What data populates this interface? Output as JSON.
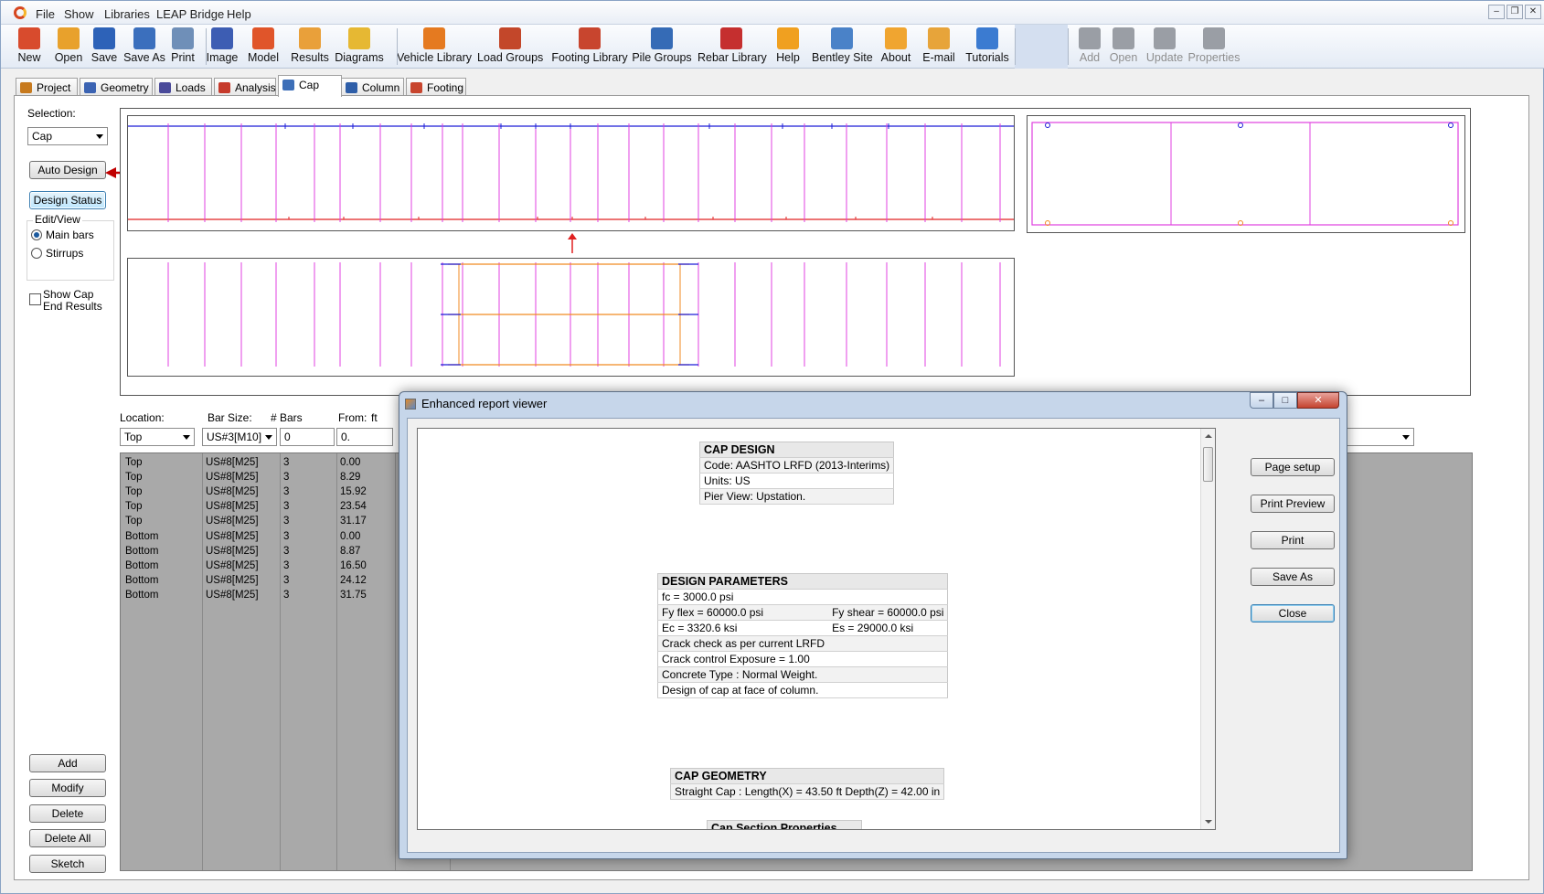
{
  "menu": [
    "File",
    "Show",
    "Libraries",
    "LEAP Bridge",
    "Help"
  ],
  "toolbar": [
    {
      "label": "New",
      "icon": "new-file-icon",
      "color": "#d84b2d"
    },
    {
      "label": "Open",
      "icon": "open-folder-icon",
      "color": "#e8a12c"
    },
    {
      "label": "Save",
      "icon": "save-disk-icon",
      "color": "#2d62b8"
    },
    {
      "label": "Save As",
      "icon": "save-as-icon",
      "color": "#3b6fbd"
    },
    {
      "label": "Print",
      "icon": "printer-icon",
      "color": "#6f8fb8"
    },
    {
      "label": "Image",
      "icon": "image-icon",
      "color": "#3d5db3"
    },
    {
      "label": "Model",
      "icon": "model-grid-icon",
      "color": "#e0552a"
    },
    {
      "label": "Results",
      "icon": "results-icon",
      "color": "#e9a03a"
    },
    {
      "label": "Diagrams",
      "icon": "diagrams-icon",
      "color": "#e6b833"
    },
    {
      "label": "Vehicle Library",
      "icon": "truck-icon",
      "color": "#e57a20"
    },
    {
      "label": "Load Groups",
      "icon": "load-groups-icon",
      "color": "#c3472a"
    },
    {
      "label": "Footing Library",
      "icon": "footing-icon",
      "color": "#c8452e"
    },
    {
      "label": "Pile Groups",
      "icon": "pile-groups-icon",
      "color": "#356bb6"
    },
    {
      "label": "Rebar Library",
      "icon": "rebar-icon",
      "color": "#c52f2f"
    },
    {
      "label": "Help",
      "icon": "help-icon",
      "color": "#f0a020"
    },
    {
      "label": "Bentley Site",
      "icon": "bentley-site-icon",
      "color": "#4a82c8"
    },
    {
      "label": "About",
      "icon": "about-icon",
      "color": "#f0a530"
    },
    {
      "label": "E-mail",
      "icon": "email-icon",
      "color": "#e7a43a"
    },
    {
      "label": "Tutorials",
      "icon": "tutorials-icon",
      "color": "#3b7bd1"
    },
    {
      "label": "Add",
      "icon": "add-icon",
      "color": "#8a8a8a"
    },
    {
      "label": "Open",
      "icon": "open-disabled-icon",
      "color": "#8a8a8a"
    },
    {
      "label": "Update",
      "icon": "update-icon",
      "color": "#8a8a8a"
    },
    {
      "label": "Properties",
      "icon": "properties-icon",
      "color": "#8a8a8a"
    }
  ],
  "tabs": [
    {
      "label": "Project",
      "icon": "project-icon",
      "color": "#c77a1e"
    },
    {
      "label": "Geometry",
      "icon": "geometry-icon",
      "color": "#3b63b2"
    },
    {
      "label": "Loads",
      "icon": "loads-icon",
      "color": "#4a4a9a"
    },
    {
      "label": "Analysis",
      "icon": "analysis-icon",
      "color": "#c63a2b"
    },
    {
      "label": "Cap",
      "icon": "cap-icon",
      "color": "#3d6fb8"
    },
    {
      "label": "Column",
      "icon": "column-icon",
      "color": "#2e5ea8"
    },
    {
      "label": "Footing",
      "icon": "footing-tab-icon",
      "color": "#c8452e"
    }
  ],
  "left": {
    "selection_label": "Selection:",
    "selection_value": "Cap",
    "auto_design": "Auto Design",
    "design_status": "Design Status",
    "edit_view": "Edit/View",
    "main_bars": "Main bars",
    "stirrups": "Stirrups",
    "show_cap_end": "Show Cap End Results",
    "add": "Add",
    "modify": "Modify",
    "delete": "Delete",
    "delete_all": "Delete All",
    "sketch": "Sketch"
  },
  "bar_editor": {
    "location_label": "Location:",
    "bar_size_label": "Bar Size:",
    "nbars_label": "# Bars",
    "from_label": "From:",
    "from_unit": "ft",
    "location_value": "Top",
    "bar_size_value": "US#3[M10]",
    "nbars_value": "0",
    "from_value": "0."
  },
  "bars": [
    {
      "location": "Top",
      "size": "US#8[M25]",
      "count": "3",
      "from": "0.00"
    },
    {
      "location": "Top",
      "size": "US#8[M25]",
      "count": "3",
      "from": "8.29"
    },
    {
      "location": "Top",
      "size": "US#8[M25]",
      "count": "3",
      "from": "15.92"
    },
    {
      "location": "Top",
      "size": "US#8[M25]",
      "count": "3",
      "from": "23.54"
    },
    {
      "location": "Top",
      "size": "US#8[M25]",
      "count": "3",
      "from": "31.17"
    },
    {
      "location": "Bottom",
      "size": "US#8[M25]",
      "count": "3",
      "from": "0.00"
    },
    {
      "location": "Bottom",
      "size": "US#8[M25]",
      "count": "3",
      "from": "8.87"
    },
    {
      "location": "Bottom",
      "size": "US#8[M25]",
      "count": "3",
      "from": "16.50"
    },
    {
      "location": "Bottom",
      "size": "US#8[M25]",
      "count": "3",
      "from": "24.12"
    },
    {
      "location": "Bottom",
      "size": "US#8[M25]",
      "count": "3",
      "from": "31.75"
    }
  ],
  "viewer": {
    "title": "Enhanced report viewer",
    "buttons": [
      "Page setup",
      "Print Preview",
      "Print",
      "Save As",
      "Close"
    ],
    "cap_design": {
      "title": "CAP DESIGN",
      "rows": [
        "Code: AASHTO LRFD (2013-Interims)",
        "Units: US",
        "Pier View: Upstation."
      ]
    },
    "design_parameters": {
      "title": "DESIGN PARAMETERS",
      "rows": [
        [
          "fc = 3000.0 psi",
          ""
        ],
        [
          "Fy flex = 60000.0 psi",
          "Fy shear = 60000.0 psi"
        ],
        [
          "Ec = 3320.6 ksi",
          "Es = 29000.0 ksi"
        ],
        [
          "Crack check as per current LRFD",
          ""
        ],
        [
          "Crack control Exposure = 1.00",
          ""
        ],
        [
          "Concrete Type : Normal Weight.",
          ""
        ],
        [
          "Design of cap at face of column.",
          ""
        ]
      ]
    },
    "cap_geometry": {
      "title": "CAP GEOMETRY",
      "rows": [
        "Straight Cap : Length(X) = 43.50 ft Depth(Z) = 42.00 in"
      ]
    },
    "cap_section_title": "Cap Section Properties"
  },
  "colors": {
    "stirrup": "#e040e0",
    "top_bar": "#1c1cd8",
    "bottom_bar": "#e02020",
    "span": "#f08a20",
    "arrow": "#c00000"
  }
}
